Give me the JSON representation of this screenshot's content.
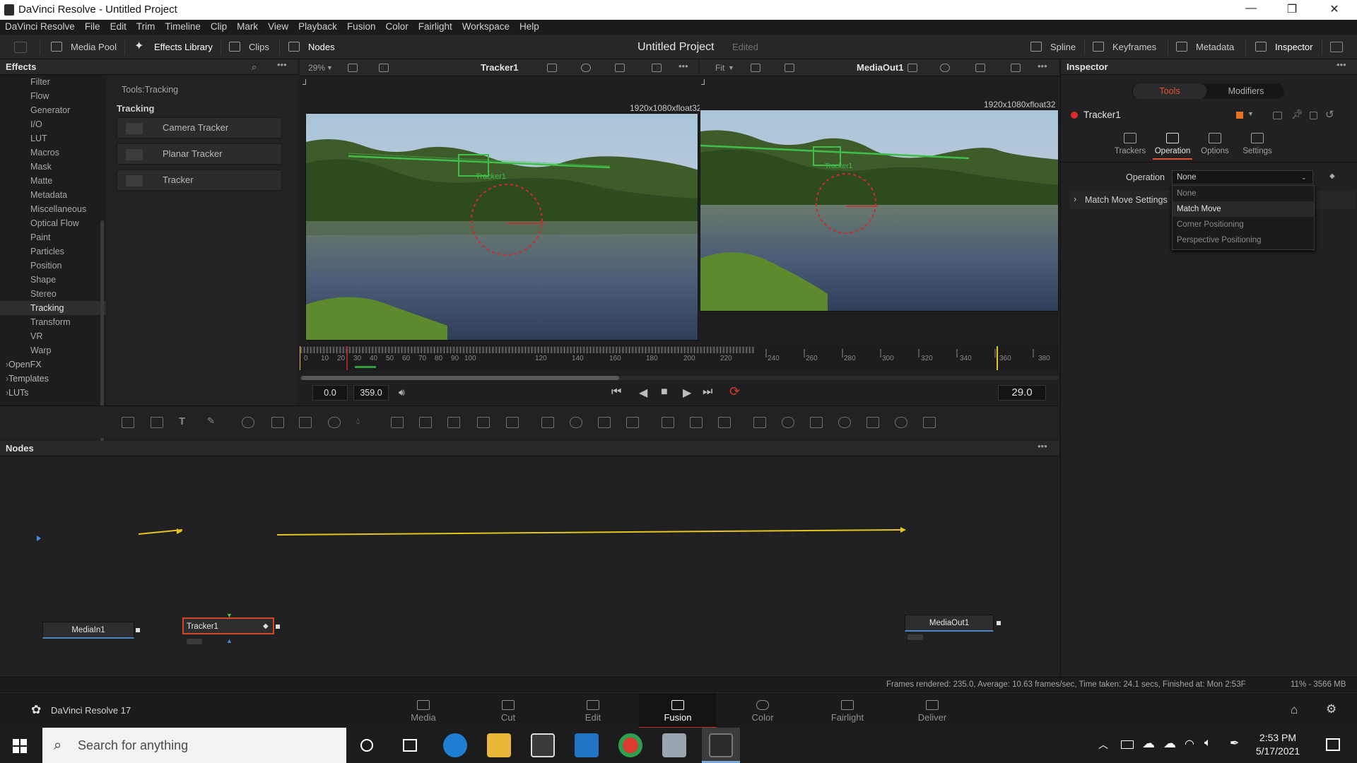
{
  "window": {
    "title": "DaVinci Resolve - Untitled Project"
  },
  "menu": [
    "DaVinci Resolve",
    "File",
    "Edit",
    "Trim",
    "Timeline",
    "Clip",
    "Mark",
    "View",
    "Playback",
    "Fusion",
    "Color",
    "Fairlight",
    "Workspace",
    "Help"
  ],
  "toolbar": {
    "media_pool": "Media Pool",
    "effects_library": "Effects Library",
    "clips": "Clips",
    "nodes": "Nodes",
    "project_title": "Untitled Project",
    "edited": "Edited",
    "spline": "Spline",
    "keyframes": "Keyframes",
    "metadata": "Metadata",
    "inspector": "Inspector"
  },
  "effects": {
    "header": "Effects",
    "categories": [
      "Filter",
      "Flow",
      "Generator",
      "I/O",
      "LUT",
      "Macros",
      "Mask",
      "Matte",
      "Metadata",
      "Miscellaneous",
      "Optical Flow",
      "Paint",
      "Particles",
      "Position",
      "Shape",
      "Stereo",
      "Tracking",
      "Transform",
      "VR",
      "Warp"
    ],
    "groups": [
      "OpenFX",
      "Templates",
      "LUTs"
    ],
    "path": "Tools:Tracking",
    "section": "Tracking",
    "tools": [
      "Camera Tracker",
      "Planar Tracker",
      "Tracker"
    ]
  },
  "viewer_left": {
    "zoom": "29%",
    "name": "Tracker1",
    "resolution": "1920x1080xfloat32",
    "tracker_label": "Tracker1"
  },
  "viewer_right": {
    "zoom": "Fit",
    "name": "MediaOut1",
    "resolution": "1920x1080xfloat32",
    "tracker_label": "Tracker1"
  },
  "timeline": {
    "ticks": [
      "0",
      "10",
      "20",
      "30",
      "40",
      "50",
      "60",
      "70",
      "80",
      "90",
      "100",
      "120",
      "140",
      "160",
      "180",
      "200",
      "220",
      "240",
      "260",
      "280",
      "300",
      "320",
      "340",
      "360",
      "380"
    ],
    "start": "0.0",
    "end": "359.0",
    "current": "29.0"
  },
  "nodes_panel": {
    "header": "Nodes",
    "media_in": "MediaIn1",
    "tracker": "Tracker1",
    "media_out": "MediaOut1"
  },
  "status": {
    "frames": "Frames rendered: 235.0,  Average: 10.63 frames/sec,  Time taken: 24.1 secs,  Finished at: Mon 2:53F",
    "memory": "11% - 3566 MB"
  },
  "inspector": {
    "header": "Inspector",
    "tab_tools": "Tools",
    "tab_modifiers": "Modifiers",
    "node_name": "Tracker1",
    "subtabs": [
      "Trackers",
      "Operation",
      "Options",
      "Settings"
    ],
    "operation_label": "Operation",
    "operation_value": "None",
    "options": [
      "None",
      "Match Move",
      "Corner Positioning",
      "Perspective Positioning"
    ],
    "match_move_settings": "Match Move Settings"
  },
  "pages": {
    "app_name": "DaVinci Resolve 17",
    "items": [
      "Media",
      "Cut",
      "Edit",
      "Fusion",
      "Color",
      "Fairlight",
      "Deliver"
    ],
    "active": "Fusion"
  },
  "taskbar": {
    "search": "Search for anything",
    "time": "2:53 PM",
    "date": "5/17/2021"
  },
  "colors": {
    "accent_red": "#c72828",
    "link_yellow": "#e5c51e",
    "tracker_green": "#3fbf4a",
    "node_blue": "#4c86c2"
  }
}
